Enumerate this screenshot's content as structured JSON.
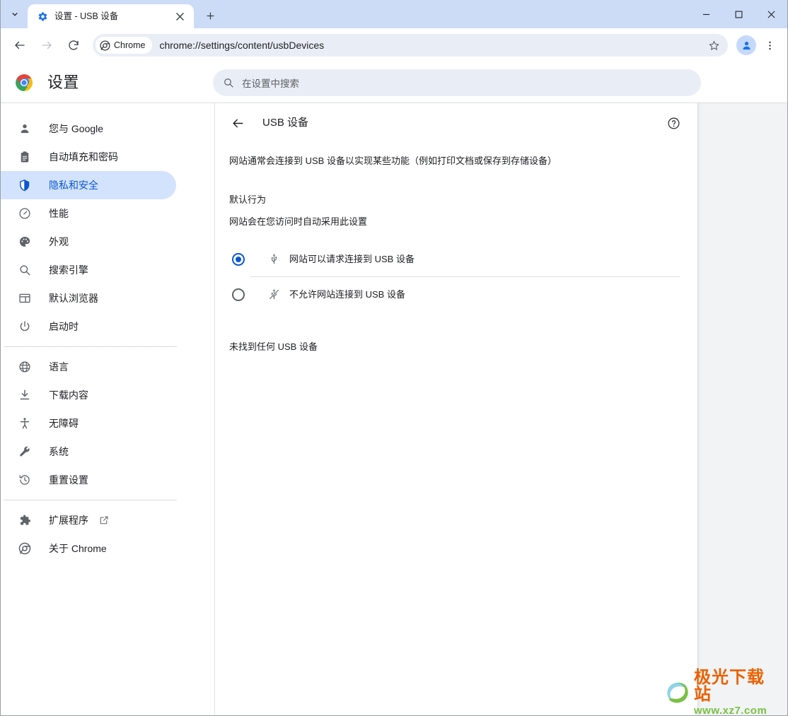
{
  "window": {
    "controls": {
      "minimize": "−",
      "maximize": "□",
      "close": "✕"
    }
  },
  "tabstrip": {
    "tab_search_icon": "chevron-down-icon",
    "new_tab_label": "+",
    "tabs": [
      {
        "title": "设置 - USB 设备",
        "favicon": "gear-icon",
        "close_label": "✕",
        "active": true
      }
    ]
  },
  "toolbar": {
    "back_icon": "arrow-left-icon",
    "forward_icon": "arrow-right-icon",
    "reload_icon": "reload-icon",
    "chrome_chip_label": "Chrome",
    "url": "chrome://settings/content/usbDevices",
    "star_icon": "star-icon",
    "profile_icon": "person-icon",
    "menu_icon": "three-dot-menu-icon"
  },
  "settings": {
    "logo": "chrome-logo-icon",
    "title": "设置",
    "search": {
      "icon": "search-icon",
      "placeholder": "在设置中搜索",
      "value": ""
    }
  },
  "sidebar": {
    "items": [
      {
        "label": "您与 Google",
        "icon": "person-icon",
        "selected": false
      },
      {
        "label": "自动填充和密码",
        "icon": "clipboard-icon",
        "selected": false
      },
      {
        "label": "隐私和安全",
        "icon": "shield-icon",
        "selected": true
      },
      {
        "label": "性能",
        "icon": "speedometer-icon",
        "selected": false
      },
      {
        "label": "外观",
        "icon": "palette-icon",
        "selected": false
      },
      {
        "label": "搜索引擎",
        "icon": "search-icon",
        "selected": false
      },
      {
        "label": "默认浏览器",
        "icon": "browser-window-icon",
        "selected": false
      },
      {
        "label": "启动时",
        "icon": "power-icon",
        "selected": false
      },
      {
        "label": "语言",
        "icon": "globe-icon",
        "selected": false
      },
      {
        "label": "下载内容",
        "icon": "download-icon",
        "selected": false
      },
      {
        "label": "无障碍",
        "icon": "accessibility-icon",
        "selected": false
      },
      {
        "label": "系统",
        "icon": "wrench-icon",
        "selected": false
      },
      {
        "label": "重置设置",
        "icon": "history-restore-icon",
        "selected": false
      },
      {
        "label": "扩展程序",
        "icon": "puzzle-icon",
        "selected": false,
        "external": true,
        "external_icon": "open-in-new-icon"
      },
      {
        "label": "关于 Chrome",
        "icon": "chrome-logo-icon",
        "selected": false
      }
    ]
  },
  "main": {
    "back_icon": "arrow-left-icon",
    "title": "USB 设备",
    "help_icon": "help-circle-icon",
    "description": "网站通常会连接到 USB 设备以实现某些功能（例如打印文档或保存到存储设备）",
    "default_behavior_title": "默认行为",
    "default_behavior_subtitle": "网站会在您访问时自动采用此设置",
    "radio_options": [
      {
        "label": "网站可以请求连接到 USB 设备",
        "icon": "usb-icon",
        "checked": true
      },
      {
        "label": "不允许网站连接到 USB 设备",
        "icon": "usb-off-icon",
        "checked": false
      }
    ],
    "empty_state": "未找到任何 USB 设备"
  },
  "watermark": {
    "title": "极光下载站",
    "url": "www.xz7.com",
    "icon": "swirl-logo-icon",
    "title_color": "#eb6100",
    "url_color": "#7ac143"
  },
  "colors": {
    "accent": "#0b57d0",
    "selected_nav_bg": "#d3e3fd",
    "tabstrip_bg": "#ccdcf7",
    "omnibox_bg": "#e9eef6"
  }
}
